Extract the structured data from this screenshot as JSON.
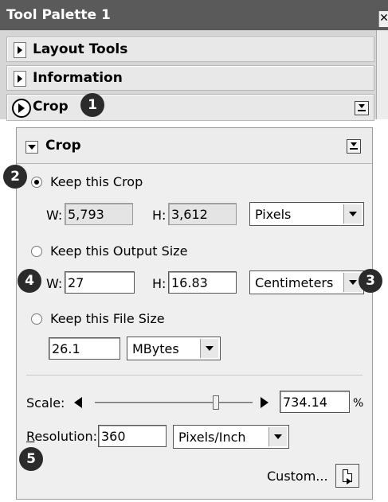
{
  "palette": {
    "title": "Tool Palette 1",
    "close_glyph": "✕",
    "rows": [
      {
        "label": "Layout Tools"
      },
      {
        "label": "Information"
      },
      {
        "label": "Crop"
      }
    ]
  },
  "badges": [
    "1",
    "2",
    "3",
    "4",
    "5"
  ],
  "crop_panel": {
    "title": "Crop",
    "keep_crop": {
      "label": "Keep this Crop",
      "selected": true,
      "w_label": "W:",
      "w_value": "5,793",
      "h_label": "H:",
      "h_value": "3,612",
      "unit": "Pixels"
    },
    "keep_output": {
      "label": "Keep this Output Size",
      "w_label": "W:",
      "w_value": "27",
      "h_label": "H:",
      "h_value": "16.83",
      "unit": "Centimeters"
    },
    "keep_file": {
      "label": "Keep this File Size",
      "size_value": "26.1",
      "unit": "MBytes"
    },
    "scale": {
      "label": "Scale:",
      "value": "734.14",
      "suffix": "%"
    },
    "resolution": {
      "label_first": "R",
      "label_rest": "esolution:",
      "value": "360",
      "unit": "Pixels/Inch"
    },
    "custom_label": "Custom..."
  },
  "icons": {
    "expand": "triangle-right-icon",
    "collapse": "triangle-down-icon",
    "menu": "panel-menu-icon",
    "document": "document-icon"
  }
}
